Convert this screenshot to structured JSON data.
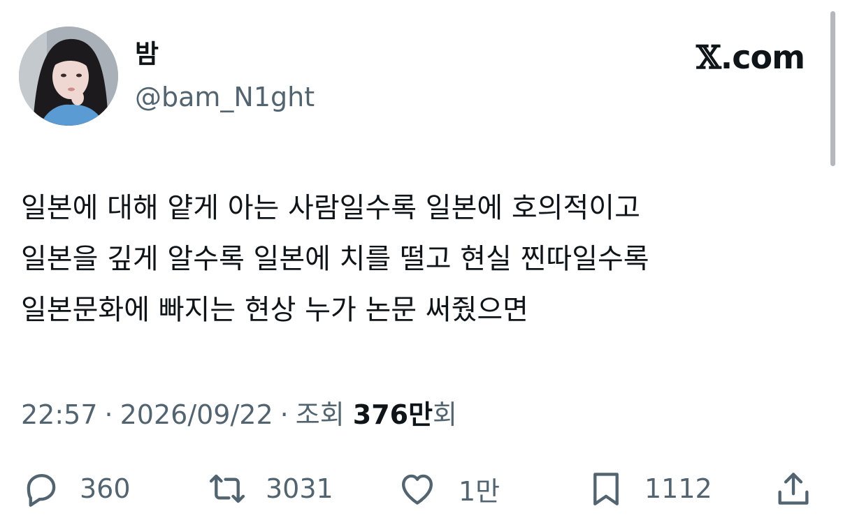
{
  "author": {
    "display_name": "밤",
    "handle": "@bam_N1ght",
    "avatar_icon": "profile-photo"
  },
  "brand": {
    "x_glyph": "𝕏",
    "domain": ".com"
  },
  "tweet": {
    "lines": [
      "일본에 대해 얕게 아는 사람일수록 일본에 호의적이고",
      "일본을 깊게 알수록 일본에 치를 떨고 현실 찐따일수록",
      "일본문화에 빠지는 현상 누가 논문 써줬으면"
    ]
  },
  "meta": {
    "time": "22:57",
    "date": "2026/09/22",
    "separator": "·",
    "views_label": "조회",
    "views_count": "376만",
    "views_suffix": "회"
  },
  "actions": {
    "reply": {
      "icon": "reply-icon",
      "count": "360"
    },
    "retweet": {
      "icon": "retweet-icon",
      "count": "3031"
    },
    "like": {
      "icon": "heart-icon",
      "count": "1만"
    },
    "bookmark": {
      "icon": "bookmark-icon",
      "count": "1112"
    },
    "share": {
      "icon": "share-icon"
    }
  },
  "colors": {
    "text": "#0f1419",
    "secondary": "#536471",
    "background": "#ffffff"
  }
}
